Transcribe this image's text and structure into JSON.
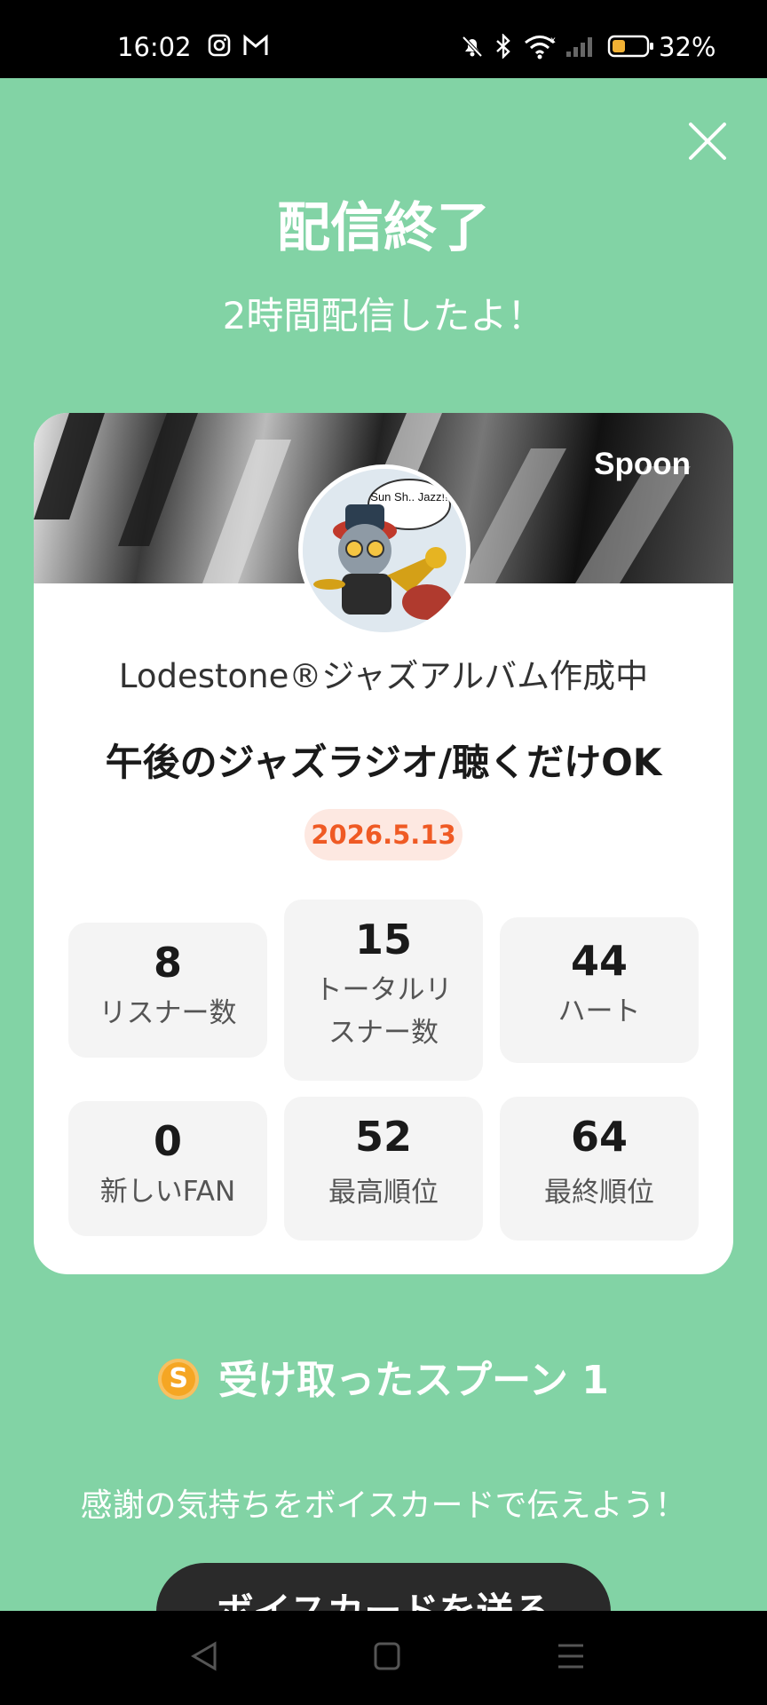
{
  "status_bar": {
    "time": "16:02",
    "battery_percent": "32%",
    "icons": [
      "instagram-icon",
      "gmail-icon",
      "mute-icon",
      "bluetooth-icon",
      "wifi-icon",
      "signal-icon",
      "battery-icon"
    ]
  },
  "header": {
    "title": "配信終了",
    "subtitle": "2時間配信したよ！"
  },
  "card": {
    "brand": "Spoon",
    "avatar_text": "Sun Sh.. Jazz!!",
    "dj_name": "Lodestone®ジャズアルバム作成中",
    "live_title": "午後のジャズラジオ/聴くだけOK",
    "date": "2026.5.13",
    "stats": [
      {
        "value": "8",
        "label": "リスナー数"
      },
      {
        "value": "15",
        "label": "トータルリ",
        "label2": "スナー数"
      },
      {
        "value": "44",
        "label": "ハート"
      },
      {
        "value": "0",
        "label": "新しいFAN"
      },
      {
        "value": "52",
        "label": "最高順位"
      },
      {
        "value": "64",
        "label": "最終順位"
      }
    ]
  },
  "spoons": {
    "coin_letter": "S",
    "label": "受け取ったスプーン 1"
  },
  "thanks_text": "感謝の気持ちをボイスカードで伝えよう！",
  "cta_label": "ボイスカードを送る",
  "colors": {
    "background": "#82d3a5",
    "date_text": "#ef5a24",
    "date_bg": "#fde8e1",
    "coin": "#f5a623",
    "cta_bg": "#2a2a2a"
  }
}
